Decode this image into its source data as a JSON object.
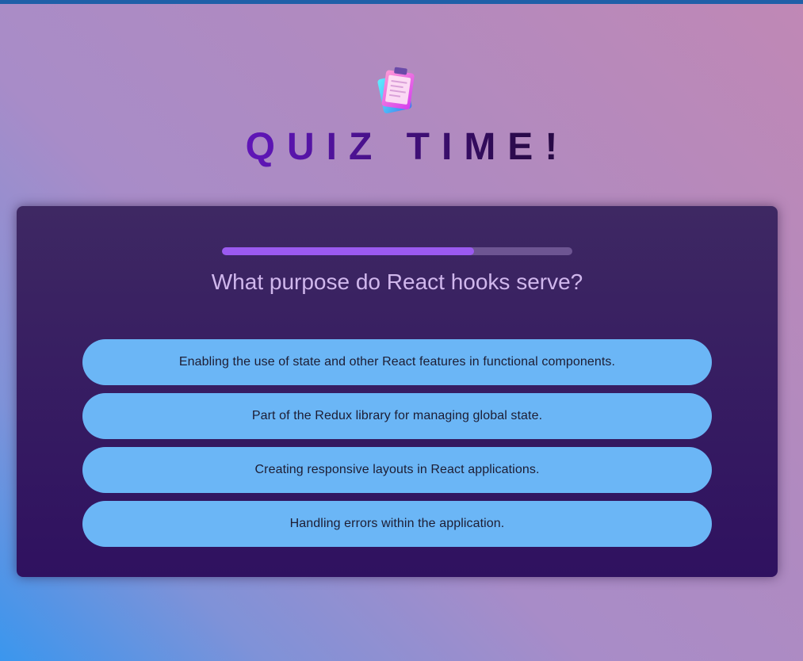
{
  "header": {
    "title": "QUIZ TIME!",
    "icon": "clipboard-icon"
  },
  "quiz": {
    "progress_percent": 72,
    "question": "What purpose do React hooks serve?",
    "answers": [
      "Enabling the use of state and other React features in functional components.",
      "Part of the Redux library for managing global state.",
      "Creating responsive layouts in React applications.",
      "Handling errors within the application."
    ]
  },
  "colors": {
    "progress_fill": "#9b5af0",
    "progress_track": "#6d5592",
    "answer_bg": "#6bb6f6",
    "card_bg": "#3e2863",
    "title_gradient_start": "#8a17e6",
    "title_gradient_end": "#1a0626"
  }
}
